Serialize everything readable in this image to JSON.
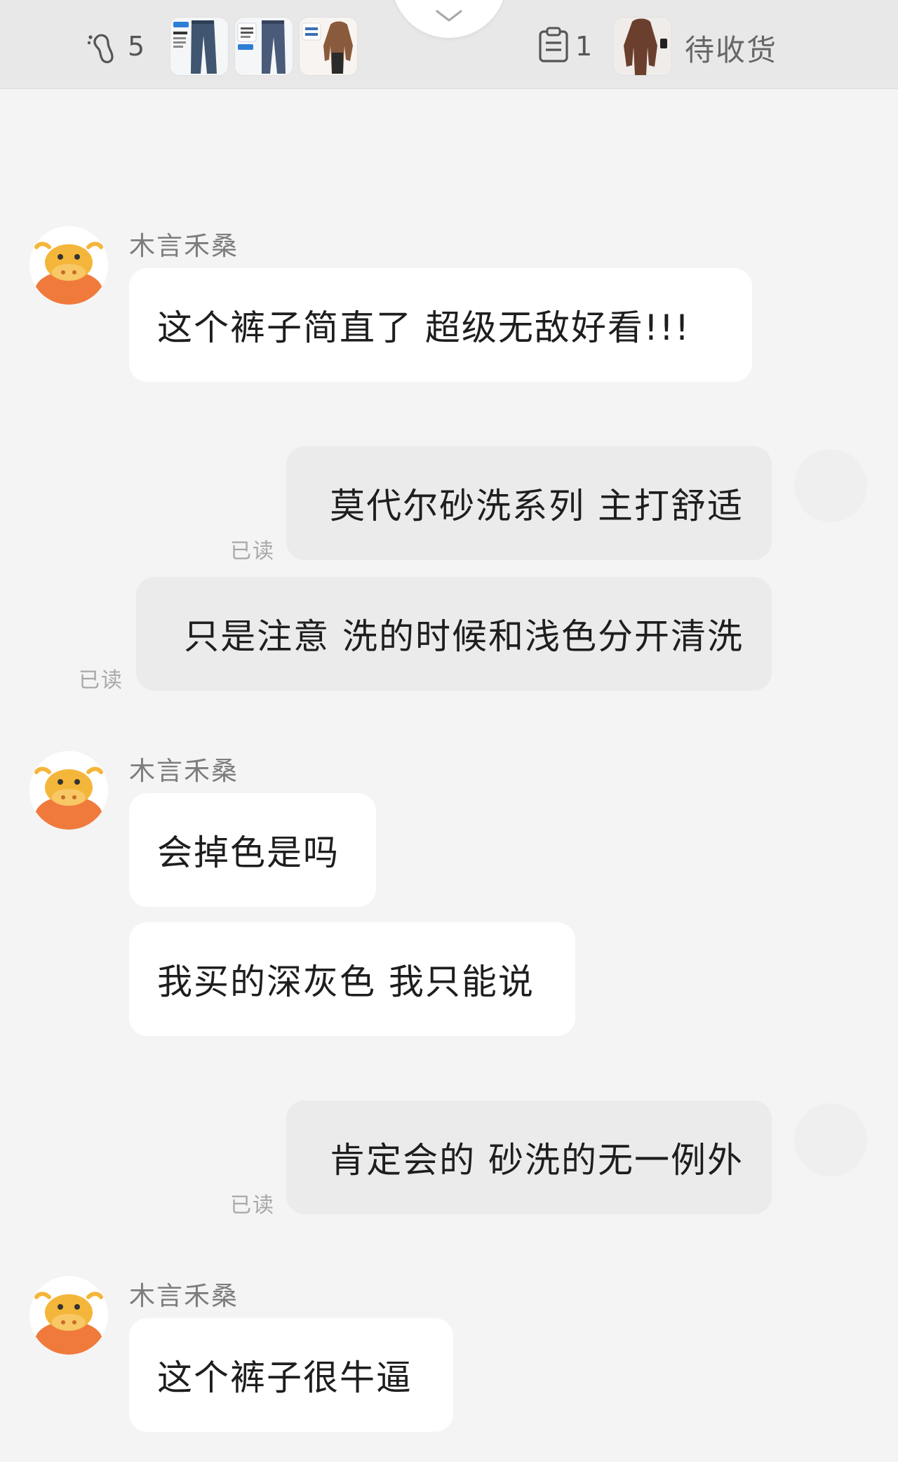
{
  "header": {
    "footprint_count": "5",
    "collapse_icon": "chevron-down-icon",
    "order_count": "1",
    "order_status": "待收货",
    "thumbnails": [
      {
        "name": "wide-leg-jeans",
        "badge": "砂洗空气裤"
      },
      {
        "name": "slim-jeans",
        "badge": "复古显瘦"
      },
      {
        "name": "brown-top",
        "badge": "水滴美背"
      }
    ]
  },
  "chat": {
    "shop_name": "木言禾桑",
    "read_label": "已读",
    "messages": [
      {
        "from": "customer",
        "text": "这个裤子简直了 超级无敌好看!!!"
      },
      {
        "from": "seller",
        "text": "莫代尔砂洗系列 主打舒适"
      },
      {
        "from": "seller",
        "text": "只是注意 洗的时候和浅色分开清洗"
      },
      {
        "from": "customer",
        "text": "会掉色是吗"
      },
      {
        "from": "customer",
        "text": "我买的深灰色 我只能说"
      },
      {
        "from": "seller",
        "text": "肯定会的 砂洗的无一例外"
      },
      {
        "from": "customer",
        "text": "这个裤子很牛逼"
      }
    ]
  },
  "colors": {
    "page_bg": "#f4f4f4",
    "header_bg": "#e8e8e8",
    "incoming_bubble": "#ffffff",
    "outgoing_bubble": "#ebebeb",
    "avatar_orange": "#f07a3c",
    "avatar_yellow": "#f4b63a"
  }
}
